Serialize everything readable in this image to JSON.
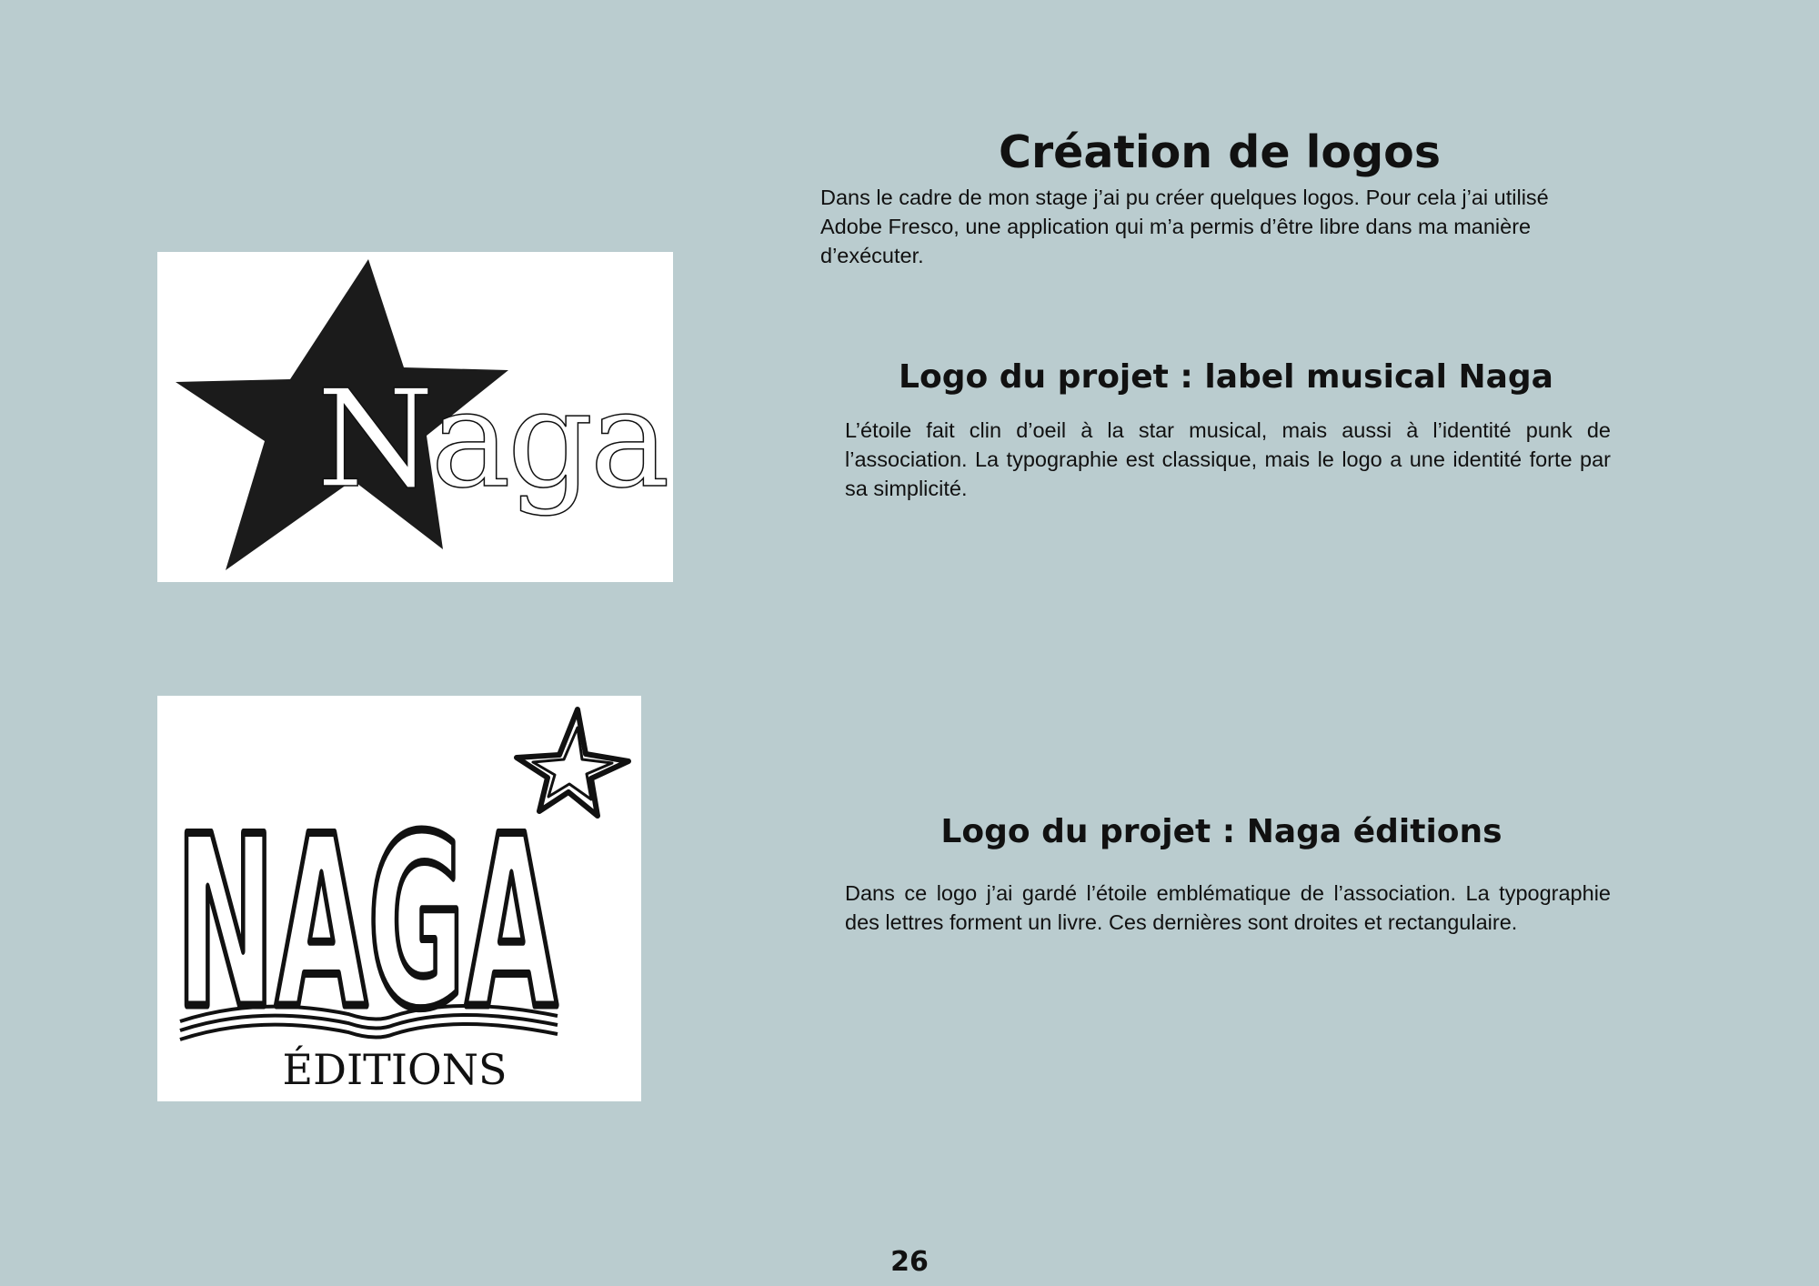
{
  "page": {
    "title": "Création de logos",
    "intro": "Dans le cadre de mon stage j’ai pu créer quelques logos. Pour cela j’ai utilisé Adobe Fresco, une application qui m’a permis d’être libre dans ma manière d’exécuter.",
    "page_number": "26",
    "background_color": "#bacccf"
  },
  "sections": [
    {
      "title": "Logo du projet : label musical Naga",
      "text": "L’étoile fait clin d’oeil à la star musical, mais aussi à l’identité punk de l’association. La typographie est classique, mais le logo a une identité forte par sa simplicité.",
      "logo": {
        "icon": "star-icon",
        "wordmark": "Naga",
        "star_color": "#1b1b1b"
      }
    },
    {
      "title": "Logo du projet : Naga éditions",
      "text": "Dans ce logo j’ai gardé l’étoile emblématique de l’association. La typographie des lettres forment un livre. Ces dernières sont droites et rectangulaire.",
      "logo": {
        "icon": "outlined-star-icon",
        "wordmark": "NAGA",
        "subtitle": "ÉDITIONS"
      }
    }
  ]
}
